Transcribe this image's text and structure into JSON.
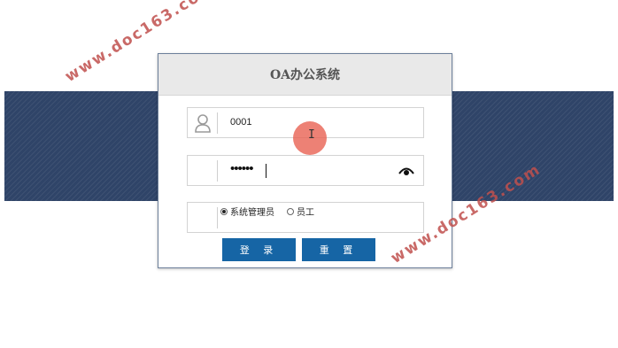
{
  "dialog": {
    "title": "OA办公系统",
    "username": {
      "value": "0001"
    },
    "password": {
      "masked_value": "••••••"
    },
    "roles": [
      {
        "label": "系统管理员",
        "selected": true
      },
      {
        "label": "员工",
        "selected": false
      }
    ],
    "buttons": {
      "login": "登 录",
      "reset": "重 置"
    }
  },
  "watermark": {
    "text": "www.doc163.com"
  },
  "colors": {
    "band": "#2f4468",
    "button": "#1665a5",
    "header_bg": "#e9e9e9",
    "cursor_highlight": "#e86252",
    "watermark": "#c0504d"
  },
  "icons": {
    "user": "user-icon",
    "eye": "eye-icon",
    "cursor": "text-cursor-icon"
  }
}
